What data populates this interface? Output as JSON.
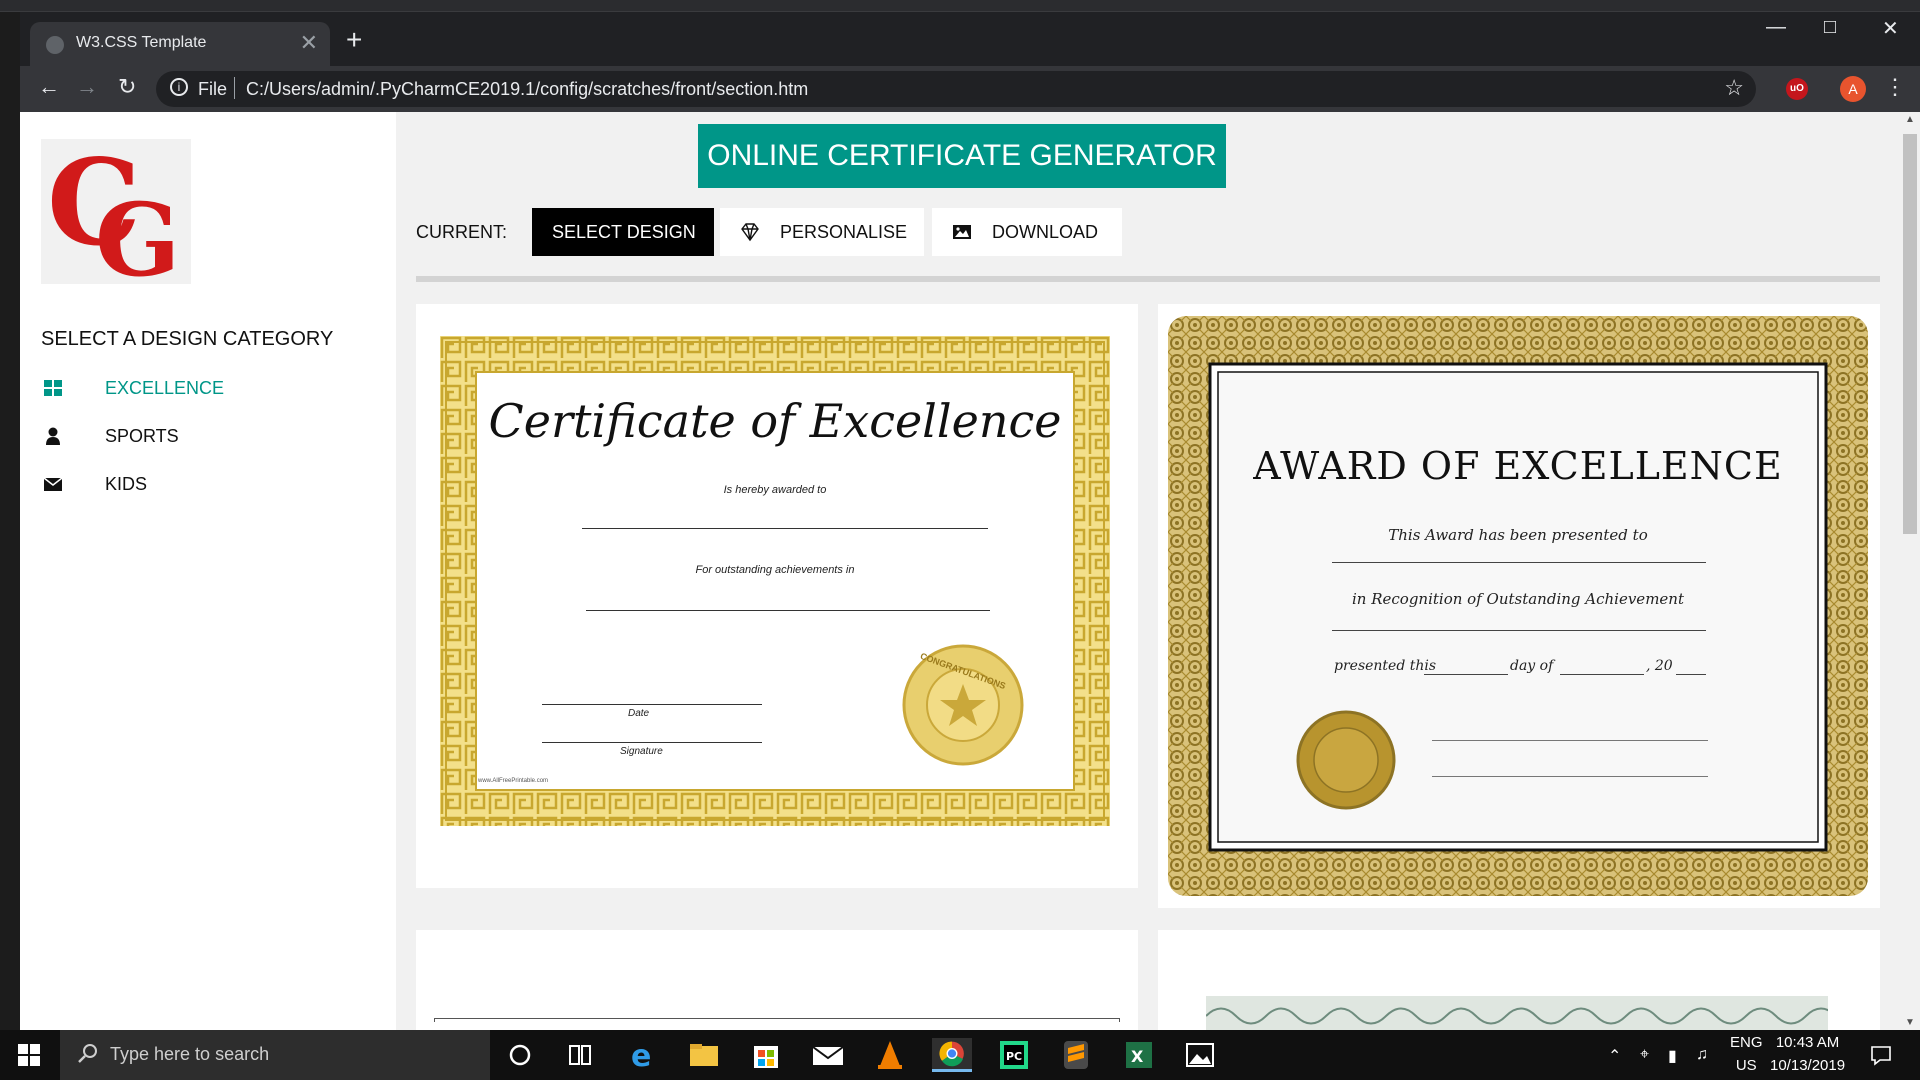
{
  "browser": {
    "tab_title": "W3.CSS Template",
    "tab_close": "✕",
    "new_tab": "+",
    "url_scheme": "File",
    "url_path": "C:/Users/admin/.PyCharmCE2019.1/config/scratches/front/section.htm",
    "profile_initial": "A",
    "ext_badge": "uO"
  },
  "sidebar": {
    "heading": "SELECT A DESIGN CATEGORY",
    "items": [
      {
        "label": "EXCELLENCE",
        "icon": "grid-icon",
        "active": true
      },
      {
        "label": "SPORTS",
        "icon": "user-icon",
        "active": false
      },
      {
        "label": "KIDS",
        "icon": "envelope-icon",
        "active": false
      }
    ]
  },
  "header": {
    "banner": "ONLINE CERTIFICATE GENERATOR",
    "current_label": "CURRENT:",
    "steps": [
      {
        "label": "SELECT DESIGN",
        "active": true
      },
      {
        "label": "PERSONALISE",
        "icon": "diamond-icon"
      },
      {
        "label": "DOWNLOAD",
        "icon": "image-icon"
      }
    ]
  },
  "certificates": {
    "cert1": {
      "title": "Certificate of Excellence",
      "awarded": "Is hereby awarded to",
      "achievement": "For outstanding achievements in",
      "date": "Date",
      "signature": "Signature",
      "seal": "CONGRATULATIONS",
      "footer": "www.AllFreePrintable.com"
    },
    "cert2": {
      "title": "AWARD OF EXCELLENCE",
      "line1": "This Award has been presented to",
      "line2": "in Recognition of Outstanding Achievement",
      "presented": "presented this",
      "day_of": "day of",
      "year": ", 20"
    }
  },
  "taskbar": {
    "search_placeholder": "Type here to search",
    "lang_top": "ENG",
    "lang_bottom": "US",
    "time": "10:43 AM",
    "date": "10/13/2019"
  },
  "colors": {
    "accent": "#009688",
    "logo_red": "#d11a1a",
    "gold": "#c8a72f"
  }
}
